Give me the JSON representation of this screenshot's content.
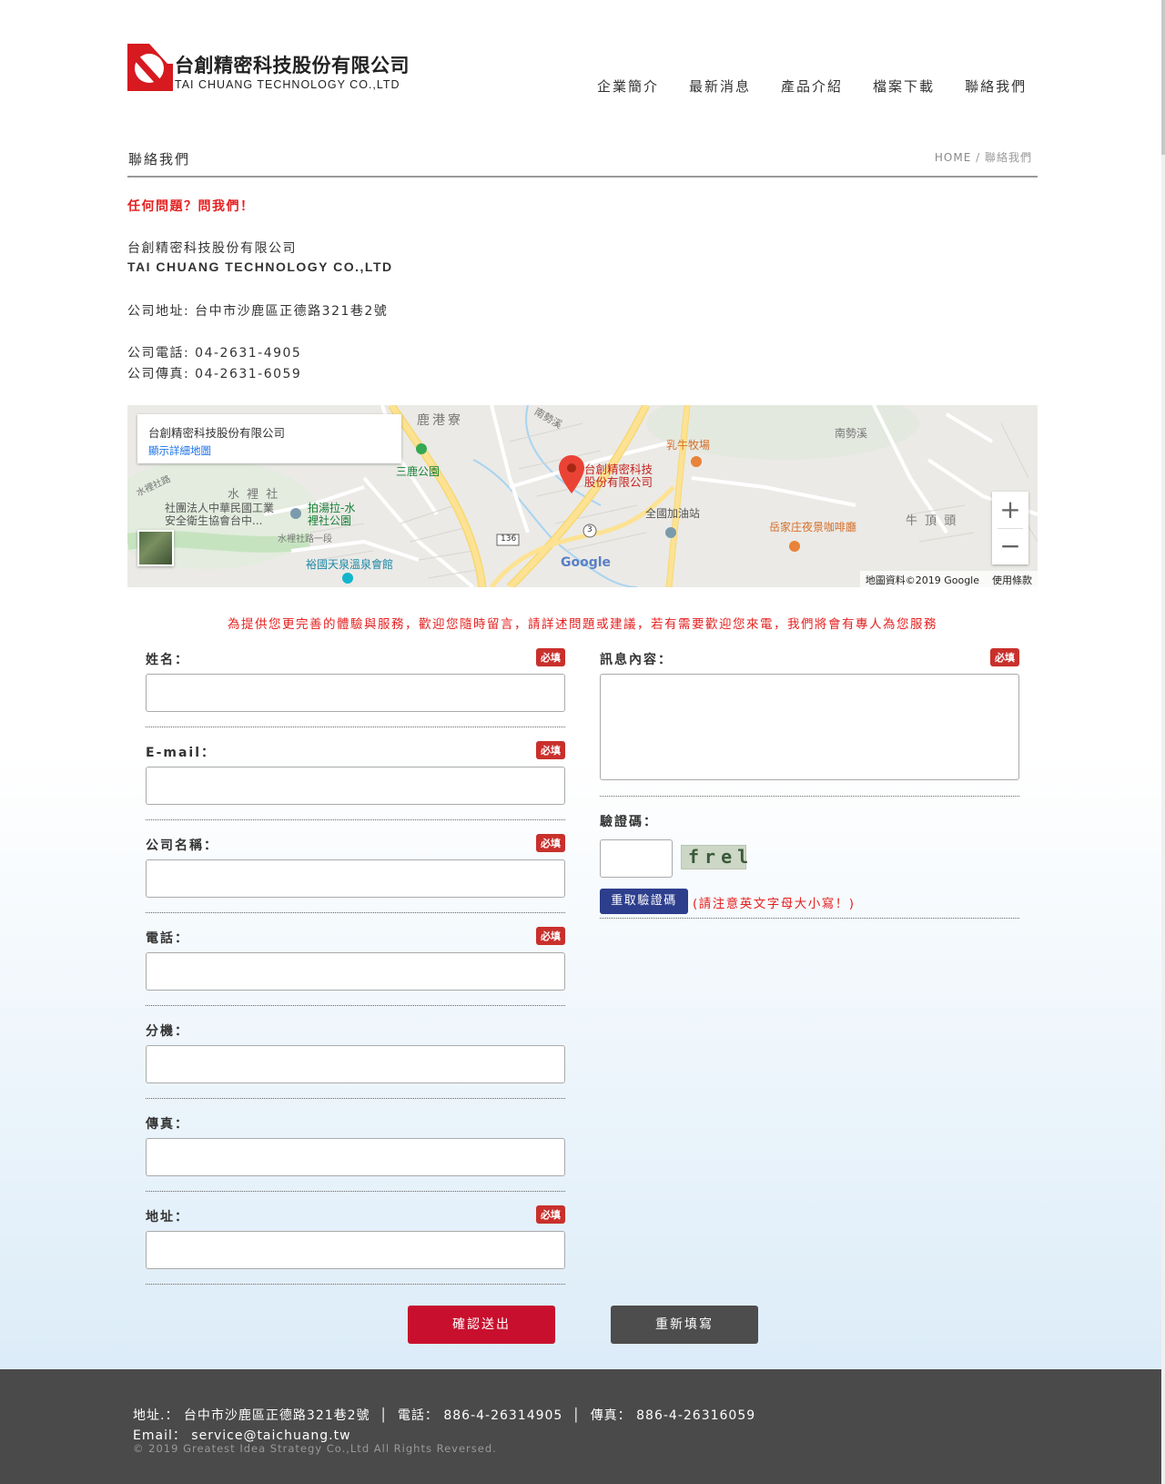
{
  "header": {
    "logo_cn": "台創精密科技股份有限公司",
    "logo_en": "TAI CHUANG TECHNOLOGY CO.,LTD",
    "nav": [
      "企業簡介",
      "最新消息",
      "產品介紹",
      "檔案下載",
      "聯絡我們"
    ]
  },
  "page": {
    "title": "聯絡我們",
    "breadcrumb_home": "HOME",
    "breadcrumb_sep": "/",
    "breadcrumb_current": "聯絡我們"
  },
  "contact": {
    "ask": "任何問題？問我們！",
    "company_cn": "台創精密科技股份有限公司",
    "company_en": "TAI CHUANG TECHNOLOGY CO.,LTD",
    "address": "公司地址: 台中市沙鹿區正德路321巷2號",
    "phone": "公司電話: 04-2631-4905",
    "fax": "公司傳真: 04-2631-6059"
  },
  "map": {
    "card_title": "台創精密科技股份有限公司",
    "card_link": "顯示詳細地圖",
    "pin_label_1": "台創精密科技",
    "pin_label_2": "股份有限公司",
    "labels": {
      "lugang": "鹿港寮",
      "nanshi": "南勢溪",
      "nanshi2": "南勢溪",
      "milk": "乳牛牧場",
      "sanlu": "三鹿公園",
      "shuili": "水 裡 社",
      "shuili_road": "水裡社路",
      "assoc1": "社團法人中華民國工業",
      "assoc2": "安全衛生協會台中...",
      "pat1": "拍湯拉-水",
      "pat2": "裡社公園",
      "station": "全國加油站",
      "cafe": "岳家庄夜景咖啡廳",
      "niuding": "牛 頂 頭",
      "yuguo": "裕國天泉溫泉會館",
      "shuili_rd1": "水裡社路一段",
      "route136": "136",
      "route3": "3"
    },
    "zoom_in": "+",
    "zoom_out": "−",
    "google": "Google",
    "data_credit": "地圖資料©2019 Google",
    "terms": "使用條款"
  },
  "note": "為提供您更完善的體驗與服務，歡迎您隨時留言，請詳述問題或建議，若有需要歡迎您來電，我們將會有專人為您服務",
  "form": {
    "required": "必填",
    "name": "姓名：",
    "email": "E-mail：",
    "company": "公司名稱：",
    "tel": "電話：",
    "ext": "分機：",
    "fax": "傳真：",
    "address": "地址：",
    "message": "訊息內容：",
    "captcha": "驗證碼：",
    "captcha_text": "frel",
    "refresh": "重取驗證碼",
    "case_note": "(請注意英文字母大小寫！)",
    "submit": "確認送出",
    "reset": "重新填寫"
  },
  "footer": {
    "address_label": "地址.：",
    "address": "台中市沙鹿區正德路321巷2號",
    "phone_label": "電話：",
    "phone": "886-4-26314905",
    "fax_label": "傳真：",
    "fax": "886-4-26316059",
    "email_label": "Email：",
    "email": "service@taichuang.tw",
    "copyright": "© 2019 Greatest Idea Strategy Co.,Ltd All Rights Reversed."
  },
  "colors": {
    "accent_red": "#e51f1f",
    "brand_red": "#c8102e",
    "button_blue": "#2d3e8d",
    "footer_bg": "#4a4a4a"
  }
}
